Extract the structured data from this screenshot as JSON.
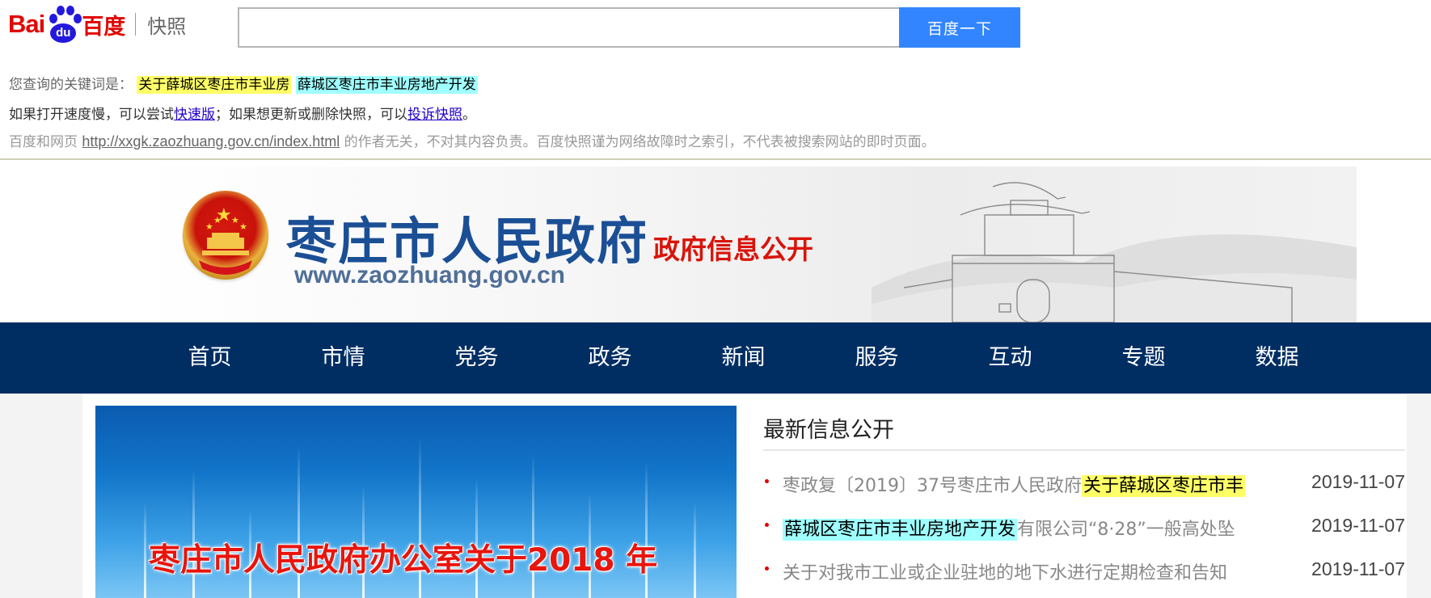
{
  "baidu": {
    "logo": {
      "left": "Bai",
      "paw": "du",
      "cn": "百度",
      "kuaizhao": "快照"
    },
    "search": {
      "value": "",
      "placeholder": "",
      "button": "百度一下"
    },
    "keywords_label": "您查询的关键词是：",
    "keywords": [
      "关于薛城区枣庄市丰业房",
      "薛城区枣庄市丰业房地产开发"
    ],
    "notice": {
      "part1": "如果打开速度慢，可以尝试",
      "fast_link": "快速版",
      "part2": "；如果想更新或删除快照，可以",
      "complain_link": "投诉快照",
      "part3": "。"
    },
    "disclaimer": {
      "prefix": "百度和网页 ",
      "url": "http://xxgk.zaozhuang.gov.cn/index.html",
      "suffix": " 的作者无关，不对其内容负责。百度快照谨为网络故障时之索引，不代表被搜索网站的即时页面。"
    },
    "colors": {
      "brand_red": "#e10601",
      "brand_blue": "#2319dc",
      "button_blue": "#3385ff",
      "hl_yellow": "#ffff66",
      "hl_cyan": "#a0ffff"
    }
  },
  "site": {
    "title": "枣庄市人民政府",
    "subtitle": "政府信息公开",
    "url": "www.zaozhuang.gov.cn",
    "nav": [
      "首页",
      "市情",
      "党务",
      "政务",
      "新闻",
      "服务",
      "互动",
      "专题",
      "数据"
    ],
    "nav_color": "#002e63",
    "slide_caption": "枣庄市人民政府办公室关于2018 年",
    "news_title": "最新信息公开",
    "news": [
      {
        "text_plain": "枣政复〔2019〕37号枣庄市人民政府",
        "text_hl": "关于薛城区枣庄市丰",
        "hl": "yellow",
        "text_after": "",
        "date": "2019-11-07"
      },
      {
        "text_plain": "",
        "text_hl": "薛城区枣庄市丰业房地产开发",
        "hl": "cyan",
        "text_after": "有限公司“8·28”一般高处坠",
        "date": "2019-11-07"
      },
      {
        "text_plain": "关于对我市工业或企业驻地的地下水进行定期检查和告知",
        "text_hl": "",
        "hl": "",
        "text_after": "",
        "date": "2019-11-07"
      }
    ]
  }
}
